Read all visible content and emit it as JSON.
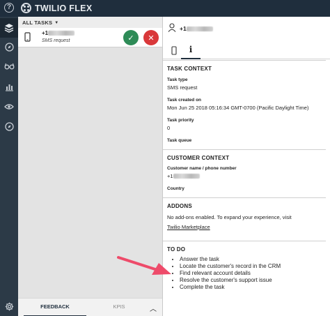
{
  "app": {
    "title": "TWILIO FLEX"
  },
  "rail": {
    "items": [
      {
        "name": "layers-icon",
        "active": true
      },
      {
        "name": "compass-icon"
      },
      {
        "name": "glasses-icon"
      },
      {
        "name": "bar-chart-icon"
      },
      {
        "name": "eye-icon"
      },
      {
        "name": "compass-icon-2"
      },
      {
        "name": "gear-icon"
      }
    ]
  },
  "tasklist": {
    "header": "ALL TASKS",
    "task": {
      "caller_prefix": "+1",
      "channel": "SMS request"
    },
    "footer": {
      "tab_feedback": "FEEDBACK",
      "tab_kpis": "KPIS"
    }
  },
  "panel": {
    "caller_prefix": "+1",
    "task_context": {
      "title": "TASK CONTEXT",
      "type_label": "Task type",
      "type_value": "SMS request",
      "created_label": "Task created on",
      "created_value": "Mon Jun 25 2018 05:16:34 GMT-0700 (Pacific Daylight Time)",
      "priority_label": "Task priority",
      "priority_value": "0",
      "queue_label": "Task queue"
    },
    "customer_context": {
      "title": "CUSTOMER CONTEXT",
      "name_label": "Customer name / phone number",
      "name_value_prefix": "+1",
      "country_label": "Country"
    },
    "addons": {
      "title": "ADDONS",
      "text": "No add-ons enabled. To expand your experience, visit",
      "link": "Twilio Marketplace"
    },
    "todo": {
      "title": "TO DO",
      "items": [
        "Answer the task",
        "Locate the customer's record in the CRM",
        "Find relevant account details",
        "Resolve the customer's support issue",
        "Complete the task"
      ]
    }
  },
  "colors": {
    "header": "#1f2e3d",
    "rail": "#2c3a47",
    "accept": "#2e8b57",
    "reject": "#d9383a",
    "arrow": "#ee4b6a"
  }
}
